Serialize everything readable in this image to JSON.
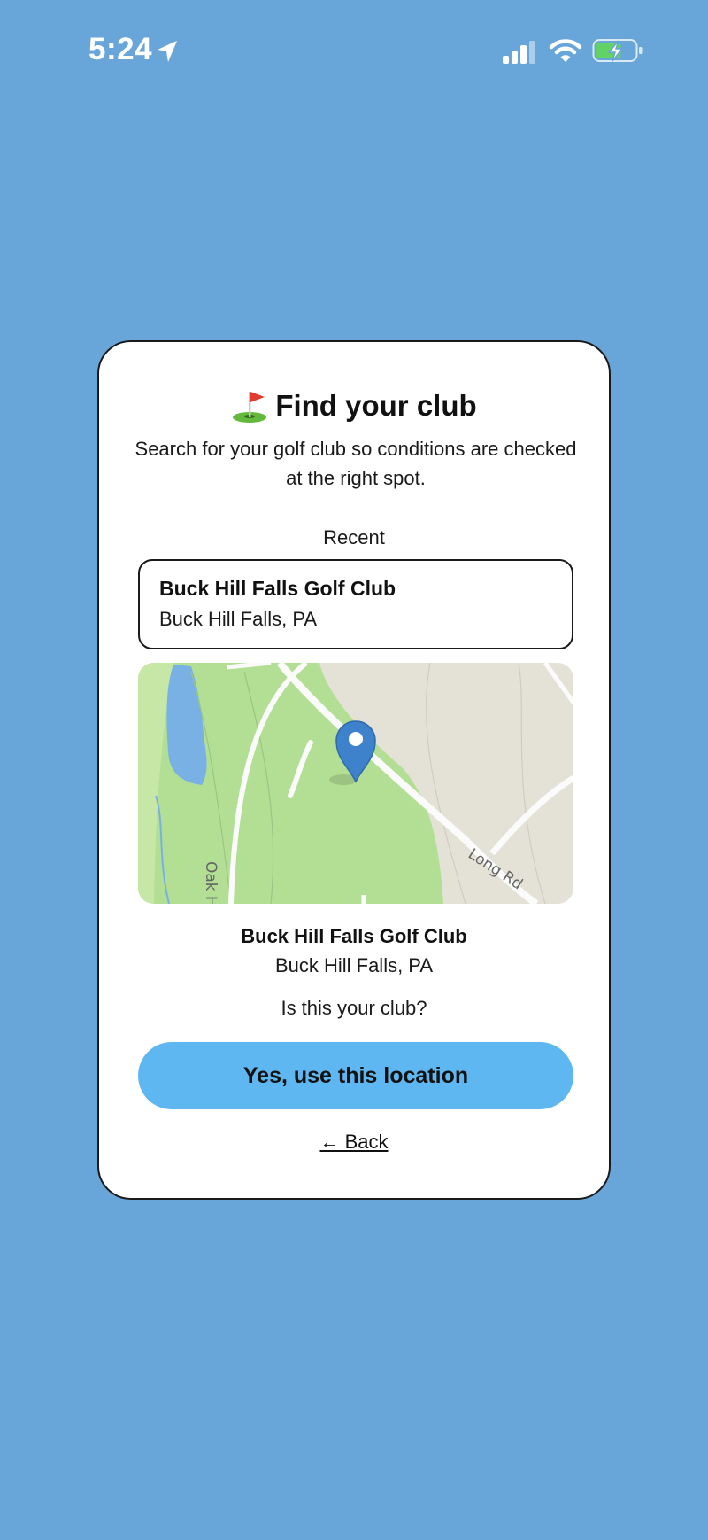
{
  "status_bar": {
    "time": "5:24",
    "icons": [
      "location-arrow-icon",
      "cellular-signal-icon",
      "wifi-icon",
      "battery-charging-icon"
    ]
  },
  "card": {
    "title_icon": "golf-flag-icon",
    "title": "Find your club",
    "subtitle": "Search for your golf club so conditions are checked at the right spot.",
    "recent_label": "Recent",
    "recent_items": [
      {
        "name": "Buck Hill Falls Golf Club",
        "location": "Buck Hill Falls, PA"
      }
    ],
    "map": {
      "road_labels": [
        "Oak H",
        "Long Rd"
      ],
      "pin_icon": "map-pin-icon"
    },
    "selected": {
      "name": "Buck Hill Falls Golf Club",
      "location": "Buck Hill Falls, PA"
    },
    "question": "Is this your club?",
    "confirm_label": "Yes, use this location",
    "back_label": "← Back"
  },
  "colors": {
    "background": "#68a6da",
    "button": "#5fb7f2",
    "map_green": "#b2df94",
    "map_land": "#e4e2d7",
    "map_water": "#7ab1e4",
    "pin": "#3f82cc"
  }
}
